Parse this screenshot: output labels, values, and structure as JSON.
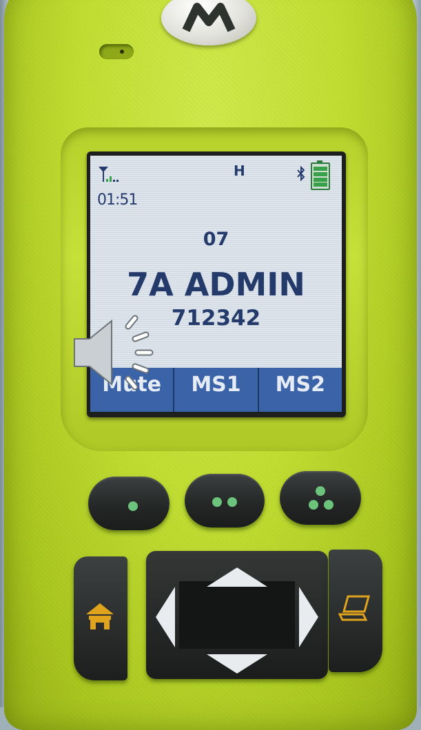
{
  "status_bar": {
    "signal_icon": "signal-strength-icon",
    "mode_indicator": "H",
    "bluetooth_icon": "bluetooth-icon",
    "battery_icon": "battery-full-icon",
    "battery_level": 1.0
  },
  "display": {
    "time": "01:51",
    "zone": "07",
    "channel": "7A ADMIN",
    "talkgroup": "712342"
  },
  "softkeys": [
    {
      "label": "Mute"
    },
    {
      "label": "MS1"
    },
    {
      "label": "MS2"
    }
  ],
  "overlay": {
    "icon": "speaker-audio-icon"
  },
  "buttons": {
    "one_dot": "one-dot-key",
    "two_dot": "two-dot-key",
    "three_dot": "three-dot-key",
    "home_icon": "home-icon",
    "app_icon": "laptop-icon",
    "nav_icons": [
      "up-arrow-icon",
      "down-arrow-icon",
      "left-arrow-icon",
      "right-arrow-icon"
    ]
  },
  "colors": {
    "body": "#c1dd33",
    "lcd_bg": "#dfe6ee",
    "lcd_text": "#233a6b",
    "softkey_bar": "#3b63a8",
    "button_dot": "#6cc47c",
    "home_icon": "#e0a41c"
  }
}
